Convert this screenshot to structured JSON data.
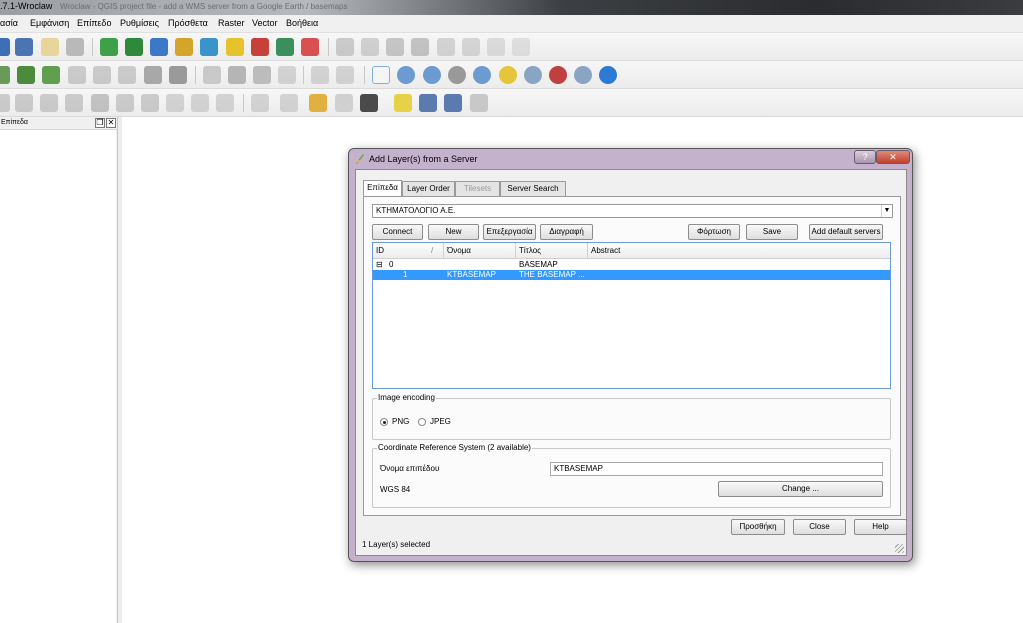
{
  "window": {
    "title": ".7.1-Wroclaw",
    "ghost_title": "Wroclaw - QGIS project file - add a WMS server from a Google Earth / basemaps"
  },
  "menu": [
    "ασία",
    "Εμφάνιση",
    "Επίπεδο",
    "Ρυθμίσεις",
    "Πρόσθετα",
    "Raster",
    "Vector",
    "Βοήθεια"
  ],
  "left_panel": {
    "title": "Επίπεδα",
    "float_glyph": "❐",
    "close_glyph": "✕"
  },
  "dialog": {
    "title": "Add Layer(s) from a Server",
    "help_glyph": "?",
    "close_glyph": "✕",
    "tabs": [
      "Επίπεδα",
      "Layer Order",
      "Tilesets",
      "Server Search"
    ],
    "active_tab": "Επίπεδα",
    "disabled_tab": "Tilesets",
    "server": {
      "selected": "ΚΤΗΜΑΤΟΛΟΓΙΟ Α.Ε.",
      "arrow": "▼"
    },
    "buttons": {
      "connect": "Connect",
      "new": "New",
      "edit": "Επεξεργασία",
      "delete": "Διαγραφή",
      "load": "Φόρτωση",
      "save": "Save",
      "add_default": "Add default servers"
    },
    "columns": [
      "ID",
      "Όνομα",
      "Τίτλος",
      "Abstract"
    ],
    "sort_glyph": "/",
    "rows": [
      {
        "expander": "⊟",
        "id": "0",
        "name": "",
        "title": "BASEMAP",
        "abstract": ""
      },
      {
        "expander": "",
        "id": "1",
        "name": "KTBASEMAP",
        "title": "THE BASEMAP ...",
        "abstract": ""
      }
    ],
    "image_encoding": {
      "label": "Image encoding",
      "options": [
        "PNG",
        "JPEG"
      ],
      "selected": "PNG"
    },
    "crs": {
      "label": "Coordinate Reference System (2 available)",
      "layer_name_label": "Όνομα επιπέδου",
      "layer_name_value": "KTBASEMAP",
      "current": "WGS 84",
      "change_button": "Change ..."
    },
    "footer": {
      "add": "Προσθήκη",
      "close": "Close",
      "help": "Help"
    },
    "status": "1 Layer(s) selected"
  },
  "toolbar_icons": {
    "row1": [
      "save-project-icon",
      "save-as-icon",
      "print-composer-icon",
      "print-icon",
      "add-vector-icon",
      "add-raster-icon",
      "add-postgis-icon",
      "add-spatialite-icon",
      "add-wms-icon",
      "new-shapefile-icon",
      "remove-layer-icon",
      "add-wfs-icon",
      "add-wcs-icon",
      "edit-pencil-icon",
      "save-edits-icon",
      "move-feature-icon",
      "node-tool-icon",
      "delete-selected-icon",
      "cut-icon",
      "copy-icon",
      "paste-icon"
    ],
    "row2": [
      "layer-icon",
      "layer-icon",
      "layer-icon",
      "digitize-icon",
      "digitize-icon",
      "layer-icon",
      "layer-icon",
      "label-icon",
      "rotate-label-icon",
      "change-label-icon",
      "move-label-icon",
      "simplify-icon",
      "split-icon",
      "pan-hand-icon",
      "zoom-in-icon",
      "zoom-out-icon",
      "zoom-icon",
      "zoom-full-icon",
      "zoom-selection-icon",
      "zoom-layer-icon",
      "zoom-last-icon",
      "zoom-next-icon",
      "refresh-icon"
    ],
    "row3": [
      "add-part-icon",
      "add-ring-icon",
      "delete-ring-icon",
      "delete-part-icon",
      "reshape-icon",
      "offset-icon",
      "undo-icon",
      "redo-icon",
      "rotate-icon",
      "identify-icon",
      "select-icon",
      "deselect-icon",
      "attribute-table-icon",
      "measure-icon",
      "map-tips-icon",
      "bookmark-icon",
      "bookmark-list-icon",
      "text-annotation-icon"
    ]
  },
  "colors": {
    "selection": "#3399ff",
    "dialog_frame": "#bea8c8",
    "close_red": "#c0402c"
  }
}
